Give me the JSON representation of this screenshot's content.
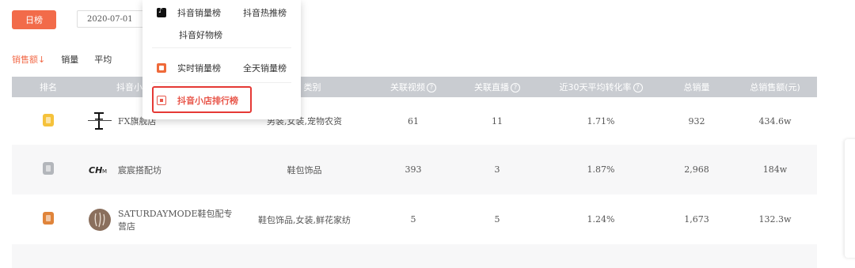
{
  "header": {
    "day_button": "日榜",
    "date_value": "2020-07-01"
  },
  "sort_tabs": [
    {
      "label": "销售额",
      "active": true,
      "arrow": "↓"
    },
    {
      "label": "销量",
      "active": false
    },
    {
      "label": "平均",
      "active": false
    }
  ],
  "table": {
    "columns": [
      "排名",
      "抖音小",
      "类别",
      "关联视频",
      "关联直播",
      "近30天平均转化率",
      "总销量",
      "总销售额(元)"
    ],
    "question_mark": "?",
    "rows": [
      {
        "medal": "gold",
        "shop": "FX旗舰店",
        "category": "男装,女装,宠物农资",
        "videos": "61",
        "lives": "11",
        "conversion": "1.71%",
        "volume": "932",
        "amount": "434.6w"
      },
      {
        "medal": "silver",
        "shop": "宸宸搭配坊",
        "category": "鞋包饰品",
        "videos": "393",
        "lives": "3",
        "conversion": "1.87%",
        "volume": "2,968",
        "amount": "184w"
      },
      {
        "medal": "bronze",
        "shop": "SATURDAYMODE鞋包配专营店",
        "category": "鞋包饰品,女装,鲜花家纺",
        "videos": "5",
        "lives": "5",
        "conversion": "1.24%",
        "volume": "1,673",
        "amount": "132.3w"
      }
    ]
  },
  "dropdown": {
    "group1": {
      "item_a": "抖音销量榜",
      "item_b": "抖音热推榜",
      "item_c": "抖音好物榜"
    },
    "group2": {
      "item_a": "实时销量榜",
      "item_b": "全天销量榜"
    },
    "group3": {
      "item_a": "抖音小店排行榜"
    }
  },
  "colors": {
    "accent": "#f26b4a",
    "header_bg": "#c9ccd1",
    "highlight_box": "#e53935"
  }
}
